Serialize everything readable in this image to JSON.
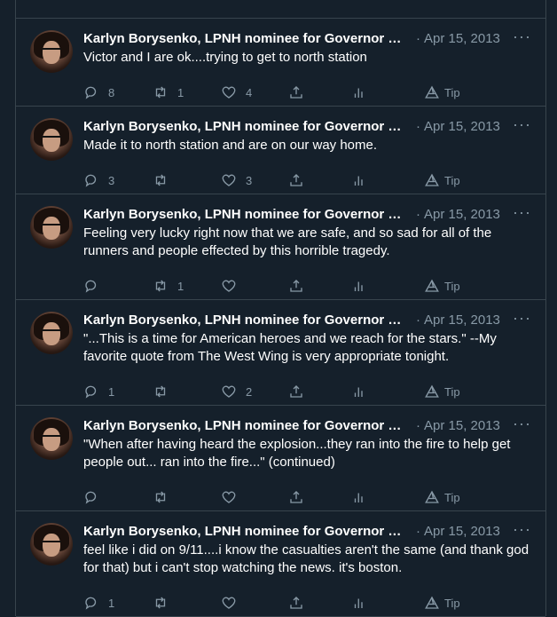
{
  "author": "Karlyn Borysenko, LPNH nominee for Governor of ...",
  "more_label": "···",
  "tweets": [
    {
      "date": "Apr 15, 2013",
      "dot": "·",
      "text": "Victor and I are ok....trying to get to north station",
      "replies": "8",
      "retweets": "1",
      "likes": "4",
      "tip": "Tip"
    },
    {
      "date": "Apr 15, 2013",
      "dot": "·",
      "text": "Made it to north station and are on our way home.",
      "replies": "3",
      "retweets": "",
      "likes": "3",
      "tip": "Tip"
    },
    {
      "date": "Apr 15, 2013",
      "dot": "·",
      "text": "Feeling very lucky right now that we are safe, and so sad for all of the runners and people effected by this horrible tragedy.",
      "replies": "",
      "retweets": "1",
      "likes": "",
      "tip": "Tip"
    },
    {
      "date": "Apr 15, 2013",
      "dot": "·",
      "text": "\"...This is a time for American heroes and we reach for the stars.\" --My favorite quote from The West Wing is very appropriate tonight.",
      "replies": "1",
      "retweets": "",
      "likes": "2",
      "tip": "Tip"
    },
    {
      "date": "Apr 15, 2013",
      "dot": "·",
      "text": "\"When after having heard the explosion...they ran into the fire to help get people out... ran into the fire...\" (continued)",
      "replies": "",
      "retweets": "",
      "likes": "",
      "tip": "Tip"
    },
    {
      "date": "Apr 15, 2013",
      "dot": "·",
      "text": "feel like i did on 9/11....i know the casualties aren't the same (and thank god for that) but i can't stop watching the news. it's boston.",
      "replies": "1",
      "retweets": "",
      "likes": "",
      "tip": "Tip"
    }
  ]
}
